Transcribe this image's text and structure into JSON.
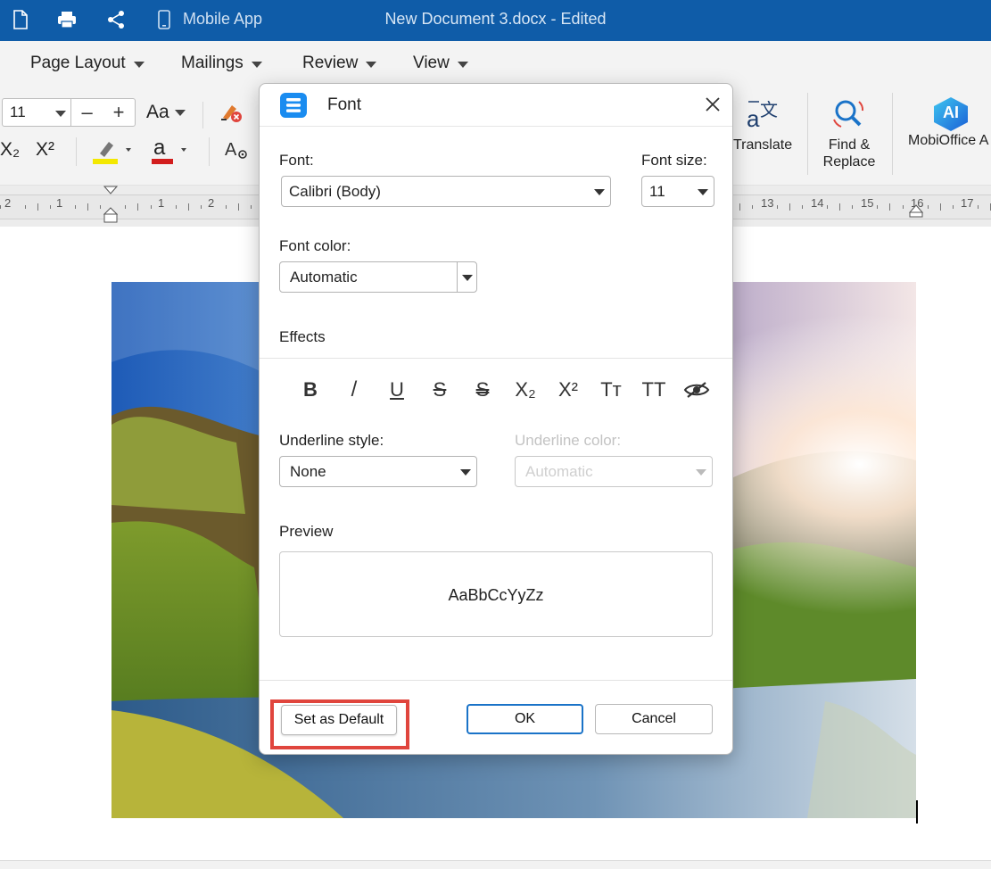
{
  "colors": {
    "brand": "#0F5CA8",
    "accent": "#1A73C8",
    "highlight": "#E0453D"
  },
  "titlebar": {
    "icons": [
      "new-document-icon",
      "print-icon",
      "share-icon",
      "mobile-icon"
    ],
    "mobile_label": "Mobile App",
    "doc_title": "New Document 3.docx - Edited"
  },
  "menu": {
    "items": [
      "Page Layout",
      "Mailings",
      "Review",
      "View"
    ]
  },
  "toolbar": {
    "font_size": "11",
    "stepper_minus": "–",
    "stepper_plus": "+",
    "case_label": "Aa",
    "subscript": "X₂",
    "superscript": "X²",
    "font_color_glyph": "a",
    "translate_label": "Translate",
    "find_replace_label_1": "Find &",
    "find_replace_label_2": "Replace",
    "ai_label": "MobiOffice A",
    "ai_badge": "AI"
  },
  "ruler": {
    "left_numbers": [
      "2",
      "1",
      "1",
      "2"
    ],
    "right_numbers": [
      "13",
      "14",
      "15",
      "16",
      "17"
    ]
  },
  "dialog": {
    "title": "Font",
    "font_label": "Font:",
    "font_value": "Calibri (Body)",
    "font_size_label": "Font size:",
    "font_size_value": "11",
    "font_color_label": "Font color:",
    "font_color_value": "Automatic",
    "effects_label": "Effects",
    "effects": {
      "bold": "B",
      "italic": "/",
      "underline": "U",
      "strikethrough": "S",
      "double_strikethrough": "S",
      "subscript": "X₂",
      "superscript": "X²",
      "small_caps": "Tт",
      "all_caps": "TT"
    },
    "underline_style_label": "Underline style:",
    "underline_style_value": "None",
    "underline_color_label": "Underline color:",
    "underline_color_value": "Automatic",
    "preview_label": "Preview",
    "preview_text": "AaBbCcYyZz",
    "set_default_label": "Set as Default",
    "ok_label": "OK",
    "cancel_label": "Cancel"
  }
}
